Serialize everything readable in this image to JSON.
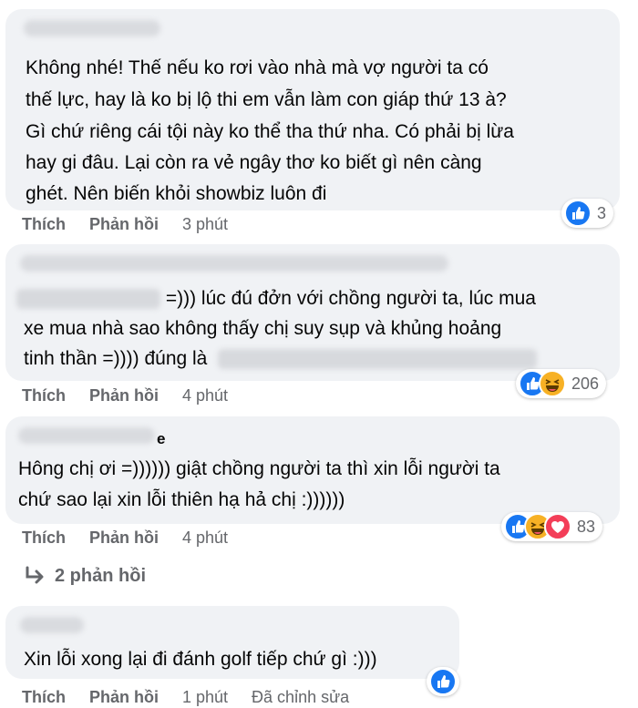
{
  "comments": [
    {
      "lines": [
        "Không nhé! Thế nếu ko rơi vào nhà mà vợ người ta có",
        "thế lực, hay là ko bị lộ thi em vẫn làm con giáp thứ 13 à?",
        "Gì chứ riêng cái tội này ko thể tha thứ nha. Có phải bị lừa",
        "hay gi đâu. Lại còn ra vẻ ngây thơ ko biết gì nên càng",
        "ghét. Nên biến khỏi showbiz luôn đi"
      ],
      "like_label": "Thích",
      "reply_label": "Phản hồi",
      "time": "3 phút",
      "reaction_count": "3"
    },
    {
      "line1_suffix": "=))) lúc đú đởn với chồng người ta, lúc mua",
      "line2": "xe mua nhà sao không thấy chị suy sụp và khủng hoảng",
      "line3_prefix": "tinh thần =)))) đúng là",
      "like_label": "Thích",
      "reply_label": "Phản hồi",
      "time": "4 phút",
      "reaction_count": "206"
    },
    {
      "author_tail": "e",
      "lines": [
        "Hông chị ơi =)))))) giật chồng người ta thì xin lỗi người ta",
        "chứ sao lại xin lỗi thiên hạ hả chị :))))))"
      ],
      "like_label": "Thích",
      "reply_label": "Phản hồi",
      "time": "4 phút",
      "reaction_count": "83",
      "replies_label": "2 phản hồi"
    },
    {
      "lines": [
        "Xin lỗi xong lại đi đánh golf tiếp chứ gì :)))"
      ],
      "like_label": "Thích",
      "reply_label": "Phản hồi",
      "time": "1 phút",
      "edited_label": "Đã chỉnh sửa"
    }
  ],
  "icons": {
    "like": "like-reaction-icon",
    "haha": "haha-reaction-icon",
    "love": "love-reaction-icon",
    "reply_arrow": "reply-arrow-icon"
  },
  "colors": {
    "bubble": "#f0f2f5",
    "meta_text": "#65676b",
    "like_blue": "#1877f2",
    "haha_yellow": "#f7b125",
    "love_red": "#f33e58"
  }
}
